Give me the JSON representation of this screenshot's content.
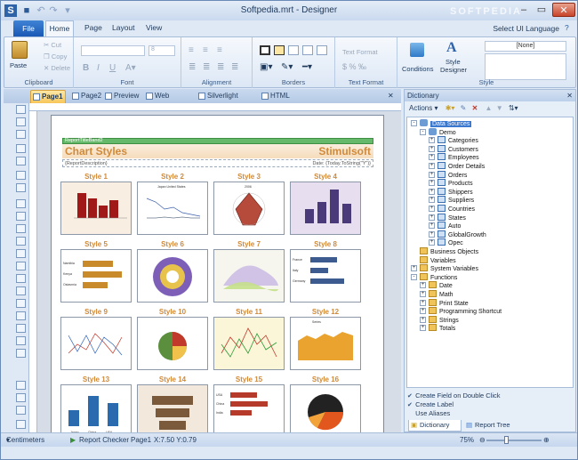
{
  "window": {
    "title": "Softpedia.mrt - Designer",
    "watermark": "SOFTPEDIA"
  },
  "ribbon": {
    "tabs": [
      "File",
      "Home",
      "Page",
      "Layout",
      "View"
    ],
    "ui_language": "Select UI Language",
    "clipboard": {
      "paste": "Paste",
      "cut": "Cut",
      "copy": "Copy",
      "delete": "Delete",
      "label": "Clipboard"
    },
    "font": {
      "label": "Font",
      "size": "8"
    },
    "alignment": {
      "label": "Alignment"
    },
    "borders": {
      "label": "Borders"
    },
    "text_format": {
      "label": "Text Format",
      "format": "Text Format"
    },
    "style": {
      "label": "Style",
      "none": "[None]",
      "conditions": "Conditions",
      "style_designer_1": "Style",
      "style_designer_2": "Designer"
    }
  },
  "doc_tabs": [
    "Page1",
    "Page2",
    "Preview",
    "Web Preview",
    "Silverlight Preview",
    "HTML Preview"
  ],
  "report": {
    "band": "ReportTitleBand2",
    "title_left": "Chart Styles",
    "title_right": "Stimulsoft",
    "desc_left": "{ReportDescription}",
    "desc_right": "Date: {Today.ToString(\"Y\")}",
    "styles": [
      "Style 1",
      "Style 2",
      "Style 3",
      "Style 4",
      "Style 5",
      "Style 6",
      "Style 7",
      "Style 8",
      "Style 9",
      "Style 10",
      "Style 11",
      "Style 12",
      "Style 13",
      "Style 14",
      "Style 15",
      "Style 16"
    ],
    "mini_labels": {
      "legend2": "Japan  United States",
      "year": "2006",
      "bar5": [
        "Namibia",
        "Kenya",
        "Ostavrnia"
      ],
      "bar8": [
        "France",
        "Italy",
        "Germany"
      ],
      "series": "Series",
      "c13": [
        "Japan",
        "China",
        "USA"
      ],
      "c15": [
        "USA",
        "China",
        "India"
      ]
    }
  },
  "dictionary": {
    "title": "Dictionary",
    "actions": "Actions",
    "tree": [
      {
        "label": "Data Sources",
        "level": 0,
        "pm": "-",
        "icon": "db",
        "selected": true
      },
      {
        "label": "Demo",
        "level": 1,
        "pm": "-",
        "icon": "db"
      },
      {
        "label": "Categories",
        "level": 2,
        "pm": "+",
        "icon": "tbl"
      },
      {
        "label": "Customers",
        "level": 2,
        "pm": "+",
        "icon": "tbl"
      },
      {
        "label": "Employees",
        "level": 2,
        "pm": "+",
        "icon": "tbl"
      },
      {
        "label": "Order Details",
        "level": 2,
        "pm": "+",
        "icon": "tbl"
      },
      {
        "label": "Orders",
        "level": 2,
        "pm": "+",
        "icon": "tbl"
      },
      {
        "label": "Products",
        "level": 2,
        "pm": "+",
        "icon": "tbl"
      },
      {
        "label": "Shippers",
        "level": 2,
        "pm": "+",
        "icon": "tbl"
      },
      {
        "label": "Suppliers",
        "level": 2,
        "pm": "+",
        "icon": "tbl"
      },
      {
        "label": "Countries",
        "level": 2,
        "pm": "+",
        "icon": "tbl"
      },
      {
        "label": "States",
        "level": 2,
        "pm": "+",
        "icon": "tbl"
      },
      {
        "label": "Auto",
        "level": 2,
        "pm": "+",
        "icon": "tbl"
      },
      {
        "label": "GlobalGrowth",
        "level": 2,
        "pm": "+",
        "icon": "tbl"
      },
      {
        "label": "Opec",
        "level": 2,
        "pm": "+",
        "icon": "tbl"
      },
      {
        "label": "Business Objects",
        "level": 0,
        "pm": "",
        "icon": "fld"
      },
      {
        "label": "Variables",
        "level": 0,
        "pm": "",
        "icon": "fld"
      },
      {
        "label": "System Variables",
        "level": 0,
        "pm": "+",
        "icon": "fld"
      },
      {
        "label": "Functions",
        "level": 0,
        "pm": "-",
        "icon": "fld"
      },
      {
        "label": "Date",
        "level": 1,
        "pm": "+",
        "icon": "fld"
      },
      {
        "label": "Math",
        "level": 1,
        "pm": "+",
        "icon": "fld"
      },
      {
        "label": "Print State",
        "level": 1,
        "pm": "+",
        "icon": "fld"
      },
      {
        "label": "Programming Shortcut",
        "level": 1,
        "pm": "+",
        "icon": "fld"
      },
      {
        "label": "Strings",
        "level": 1,
        "pm": "+",
        "icon": "fld"
      },
      {
        "label": "Totals",
        "level": 1,
        "pm": "+",
        "icon": "fld"
      }
    ],
    "options": [
      {
        "label": "Create Field on Double Click",
        "checked": true
      },
      {
        "label": "Create Label",
        "checked": true
      },
      {
        "label": "Use Aliases",
        "checked": false
      }
    ],
    "bottom_tabs": [
      "Dictionary",
      "Report Tree"
    ]
  },
  "status": {
    "units": "Centimeters",
    "checker": "Report Checker",
    "page": "Page1",
    "coords": "X:7.50  Y:0.79",
    "zoom": "75%"
  }
}
